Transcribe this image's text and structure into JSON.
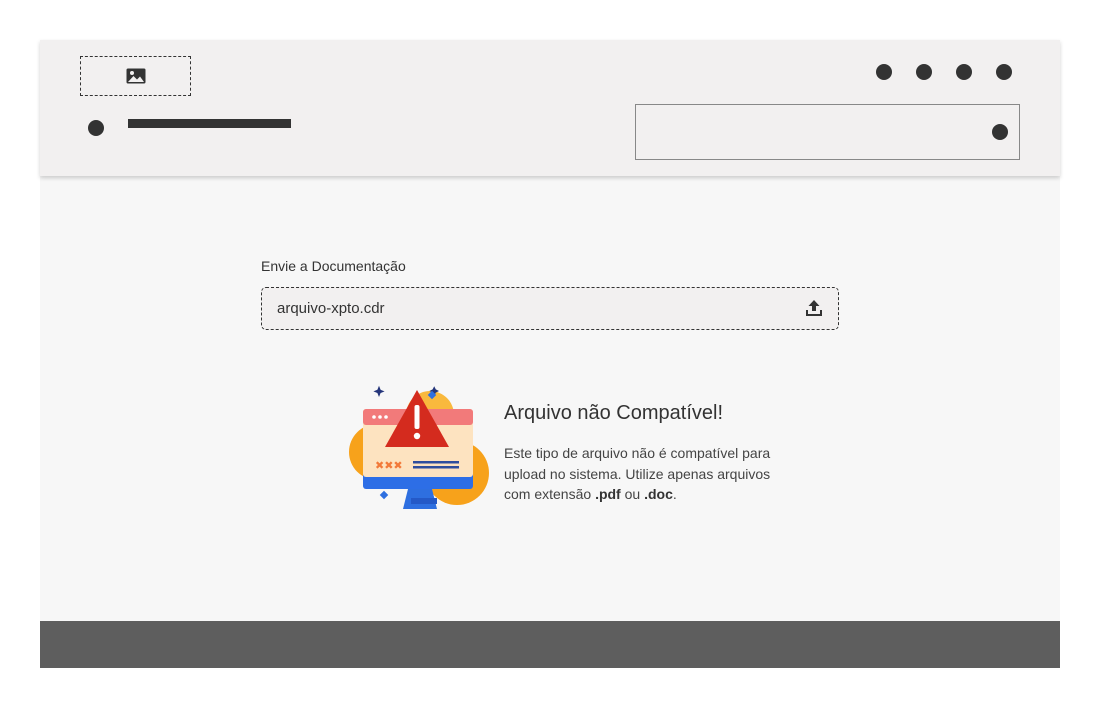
{
  "header": {
    "logo_icon": "image-icon",
    "action_dots": [
      "menu-dot-1",
      "menu-dot-2",
      "menu-dot-3",
      "menu-dot-4"
    ],
    "search_icon": "dot-icon"
  },
  "upload": {
    "label": "Envie a Documentação",
    "file_name": "arquivo-xpto.cdr",
    "upload_icon": "upload-icon"
  },
  "error": {
    "title": "Arquivo não Compatível!",
    "text_before": "Este tipo de arquivo não é compatível para upload no sistema. Utilize apenas arquivos com extensão ",
    "ext_pdf": ".pdf",
    "text_middle": " ou ",
    "ext_doc": ".doc",
    "text_after": ".",
    "illustration_icon": "warning-monitor-icon"
  },
  "colors": {
    "header_bg": "#f2f0f0",
    "page_bg": "#f7f7f7",
    "footer_bg": "#5e5e5e",
    "dark": "#333333",
    "warning_red": "#d42b1e",
    "warning_orange": "#f7a21b"
  }
}
